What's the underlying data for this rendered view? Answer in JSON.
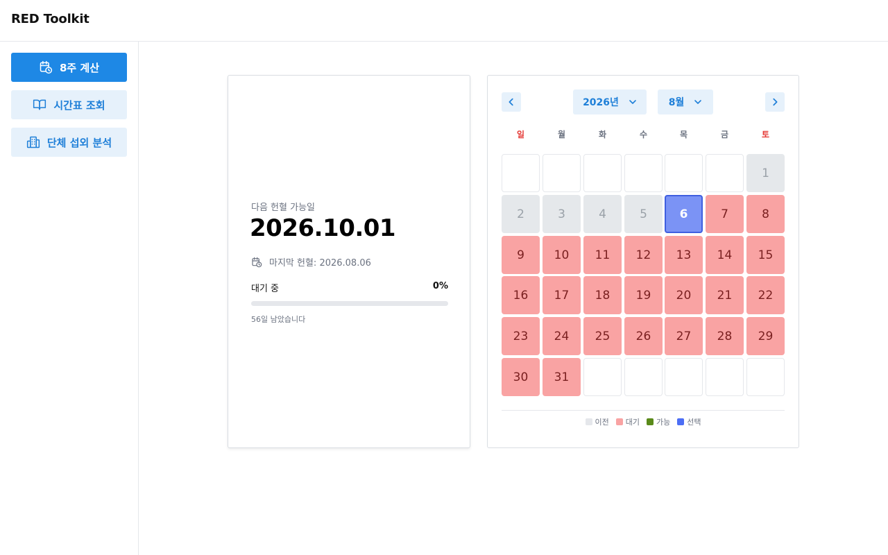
{
  "app": {
    "title": "RED Toolkit"
  },
  "sidebar": {
    "items": [
      {
        "label": "8주 계산",
        "icon": "calendar-clock-icon",
        "active": true
      },
      {
        "label": "시간표 조회",
        "icon": "book-open-icon",
        "active": false
      },
      {
        "label": "단체 섭외 분석",
        "icon": "building-icon",
        "active": false
      }
    ]
  },
  "result": {
    "next_label": "다음 헌혈 가능일",
    "next_date": "2026.10.01",
    "last_donation": "마지막 헌혈: 2026.08.06",
    "status_label": "대기 중",
    "progress_text": "0%",
    "progress_value": 0,
    "remaining_text": "56일 남았습니다"
  },
  "calendar": {
    "year_label": "2026년",
    "month_label": "8월",
    "weekdays": [
      "일",
      "월",
      "화",
      "수",
      "목",
      "금",
      "토"
    ],
    "first_weekday_index": 6,
    "days_in_month": 31,
    "cells": [
      {
        "day": "1",
        "state": "past"
      },
      {
        "day": "2",
        "state": "past"
      },
      {
        "day": "3",
        "state": "past"
      },
      {
        "day": "4",
        "state": "past"
      },
      {
        "day": "5",
        "state": "past"
      },
      {
        "day": "6",
        "state": "selected"
      },
      {
        "day": "7",
        "state": "wait"
      },
      {
        "day": "8",
        "state": "wait"
      },
      {
        "day": "9",
        "state": "wait"
      },
      {
        "day": "10",
        "state": "wait"
      },
      {
        "day": "11",
        "state": "wait"
      },
      {
        "day": "12",
        "state": "wait"
      },
      {
        "day": "13",
        "state": "wait"
      },
      {
        "day": "14",
        "state": "wait"
      },
      {
        "day": "15",
        "state": "wait"
      },
      {
        "day": "16",
        "state": "wait"
      },
      {
        "day": "17",
        "state": "wait"
      },
      {
        "day": "18",
        "state": "wait"
      },
      {
        "day": "19",
        "state": "wait"
      },
      {
        "day": "20",
        "state": "wait"
      },
      {
        "day": "21",
        "state": "wait"
      },
      {
        "day": "22",
        "state": "wait"
      },
      {
        "day": "23",
        "state": "wait"
      },
      {
        "day": "24",
        "state": "wait"
      },
      {
        "day": "25",
        "state": "wait"
      },
      {
        "day": "26",
        "state": "wait"
      },
      {
        "day": "27",
        "state": "wait"
      },
      {
        "day": "28",
        "state": "wait"
      },
      {
        "day": "29",
        "state": "wait"
      },
      {
        "day": "30",
        "state": "wait"
      },
      {
        "day": "31",
        "state": "wait"
      }
    ],
    "legend": [
      {
        "label": "이전",
        "color": "#e5e7eb"
      },
      {
        "label": "대기",
        "color": "#f9a3a3"
      },
      {
        "label": "가능",
        "color": "#5a8a1a"
      },
      {
        "label": "선택",
        "color": "#4c6ef5"
      }
    ]
  },
  "colors": {
    "accent": "#1e88e5",
    "accent_light": "#e6f1fb",
    "waiting": "#f9a3a3",
    "selected": "#7b93f5"
  }
}
